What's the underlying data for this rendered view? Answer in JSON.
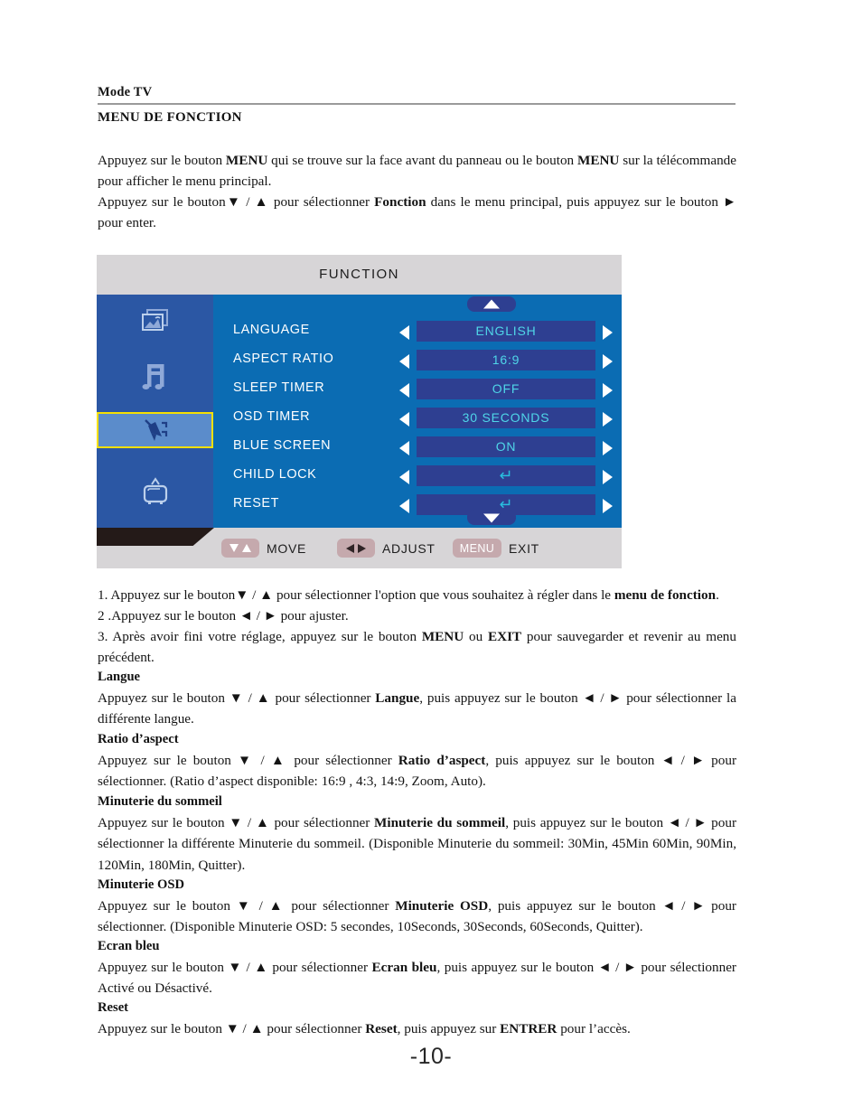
{
  "header": {
    "running_head": "Mode TV",
    "section_title": "MENU DE FONCTION"
  },
  "intro": {
    "p1_a": "Appuyez sur le bouton ",
    "p1_menu1": "MENU",
    "p1_b": " qui se trouve sur la face avant du panneau ou le bouton ",
    "p1_menu2": "MENU",
    "p1_c": " sur la télécommande pour afficher le menu principal.",
    "p2_a": "Appuyez sur le bouton▼ / ▲ pour sélectionner ",
    "p2_bold": "Fonction",
    "p2_b": " dans le menu principal, puis appuyez sur le bouton ► pour enter."
  },
  "osd": {
    "title": "FUNCTION",
    "sidebar": [
      {
        "icon": "picture-icon",
        "selected": false
      },
      {
        "icon": "music-note-icon",
        "selected": false
      },
      {
        "icon": "function-pen-icon",
        "selected": true
      },
      {
        "icon": "tv-icon",
        "selected": false
      }
    ],
    "scroll_up": "▲",
    "scroll_down": "▼",
    "rows": [
      {
        "label": "LANGUAGE",
        "value": "ENGLISH",
        "is_enter": false
      },
      {
        "label": "ASPECT RATIO",
        "value": "16:9",
        "is_enter": false
      },
      {
        "label": "SLEEP TIMER",
        "value": "OFF",
        "is_enter": false
      },
      {
        "label": "OSD TIMER",
        "value": "30 SECONDS",
        "is_enter": false
      },
      {
        "label": "BLUE SCREEN",
        "value": "ON",
        "is_enter": false
      },
      {
        "label": "CHILD LOCK",
        "value": "↵",
        "is_enter": true
      },
      {
        "label": "RESET",
        "value": "↵",
        "is_enter": true
      }
    ],
    "footer": {
      "move_label": "MOVE",
      "adjust_label": "ADJUST",
      "menu_key": "MENU",
      "exit_label": "EXIT"
    },
    "colors": {
      "header_bg": "#d7d5d7",
      "sidebar_bg": "#2b57a4",
      "panel_bg": "#0b6cb3",
      "value_box": "#2e3f91",
      "value_text": "#4fd6e8",
      "selection_border": "#f5e003",
      "selection_bg": "#5b8ccb",
      "key_pill": "#c5a9ad"
    }
  },
  "steps": {
    "s1_a": "1. Appuyez sur le bouton▼ / ▲ pour sélectionner l'option que vous souhaitez à régler dans le ",
    "s1_bold": "menu de fonction",
    "s1_b": ".",
    "s2": "2 .Appuyez sur le bouton ◄ / ► pour ajuster.",
    "s3_a": "3. Après avoir fini votre réglage, appuyez sur le bouton ",
    "s3_menu": "MENU",
    "s3_b": " ou ",
    "s3_exit": "EXIT",
    "s3_c": " pour sauvegarder et revenir au menu précédent."
  },
  "sections": [
    {
      "heading": "Langue",
      "body_a": "Appuyez sur le bouton ▼ / ▲ pour sélectionner ",
      "body_bold": "Langue",
      "body_b": ", puis appuyez sur le bouton ◄ / ► pour sélectionner la différente langue."
    },
    {
      "heading": "Ratio d’aspect",
      "body_a": "Appuyez sur le bouton ▼ / ▲ pour sélectionner ",
      "body_bold": "Ratio d’aspect",
      "body_b": ", puis appuyez sur le bouton ◄ / ► pour sélectionner. (Ratio d’aspect disponible: 16:9 , 4:3, 14:9, Zoom, Auto)."
    },
    {
      "heading": "Minuterie du sommeil",
      "body_a": "Appuyez sur le bouton ▼ / ▲ pour sélectionner ",
      "body_bold": "Minuterie du sommeil",
      "body_b": ", puis appuyez sur le bouton ◄ / ► pour sélectionner la différente Minuterie du sommeil. (Disponible Minuterie du sommeil: 30Min, 45Min 60Min, 90Min, 120Min, 180Min, Quitter)."
    },
    {
      "heading": "Minuterie OSD",
      "body_a": "Appuyez sur le bouton ▼ / ▲ pour sélectionner ",
      "body_bold": "Minuterie OSD",
      "body_b": ", puis appuyez sur le bouton ◄ / ► pour sélectionner. (Disponible Minuterie OSD: 5 secondes, 10Seconds, 30Seconds, 60Seconds, Quitter)."
    },
    {
      "heading": "Ecran bleu",
      "body_a": "Appuyez sur le bouton ▼ / ▲ pour sélectionner ",
      "body_bold": "Ecran bleu",
      "body_b": ", puis appuyez sur le bouton ◄ / ► pour sélectionner Activé ou Désactivé."
    },
    {
      "heading": "Reset",
      "body_a": "Appuyez sur le bouton ▼ / ▲ pour sélectionner ",
      "body_bold": "Reset",
      "body_b": ", puis appuyez sur ",
      "body_bold2": "ENTRER",
      "body_c": " pour l’accès."
    }
  ],
  "page_number": "-10-"
}
